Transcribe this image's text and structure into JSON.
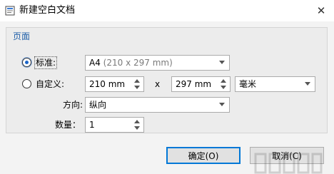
{
  "window": {
    "title": "新建空白文档"
  },
  "icons": {
    "app": "document-app-icon",
    "close": "close-icon"
  },
  "group": {
    "title": "页面"
  },
  "standard": {
    "label": "标准:",
    "selected": true,
    "value_main": "A4",
    "value_detail": "(210 x 297 mm)"
  },
  "custom": {
    "label": "自定义:",
    "selected": false,
    "width": "210 mm",
    "separator": "x",
    "height": "297 mm",
    "unit": "毫米"
  },
  "orientation": {
    "label": "方向:",
    "value": "纵向"
  },
  "quantity": {
    "label": "数量：",
    "value": "1"
  },
  "buttons": {
    "ok": "确定(O)",
    "cancel": "取消(C)"
  },
  "colors": {
    "accent": "#0078d7",
    "group_title": "#1f5fa8"
  }
}
